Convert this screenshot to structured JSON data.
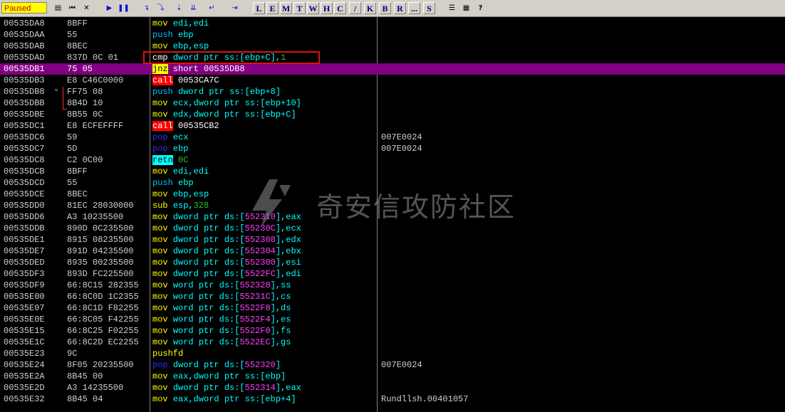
{
  "toolbar": {
    "status": "Paused",
    "icons": [
      "open-icon",
      "restart-icon",
      "close-icon",
      "run-icon",
      "pause-icon",
      "step-into-icon",
      "step-over-icon",
      "trace-into-icon",
      "trace-over-icon",
      "execute-till-return-icon",
      "go-to-icon"
    ],
    "letters": [
      "L",
      "E",
      "M",
      "T",
      "W",
      "H",
      "C",
      "/",
      "K",
      "B",
      "R",
      "...",
      "S"
    ],
    "extra_icons": [
      "options-icon",
      "colors-icon",
      "help-icon"
    ],
    "help_label": "?"
  },
  "rows": [
    {
      "addr": "00535DA8",
      "hex": "8BFF",
      "op": "mov",
      "opk": "mov",
      "args": [
        [
          "edi,edi",
          "opr-c"
        ]
      ],
      "cmt": ""
    },
    {
      "addr": "00535DAA",
      "hex": "55",
      "op": "push",
      "opk": "push",
      "args": [
        [
          "ebp",
          "opr-c"
        ]
      ],
      "cmt": ""
    },
    {
      "addr": "00535DAB",
      "hex": "8BEC",
      "op": "mov",
      "opk": "mov",
      "args": [
        [
          "ebp,esp",
          "opr-c"
        ]
      ],
      "cmt": ""
    },
    {
      "addr": "00535DAD",
      "hex": "837D 0C 01",
      "op": "cmp",
      "opk": "cmp",
      "args": [
        [
          "dword ptr ss:[ebp+C],",
          "opr-c"
        ],
        [
          "1",
          "imm"
        ]
      ],
      "cmt": ""
    },
    {
      "addr": "00535DB1",
      "hex": "75 05",
      "op": "jnz",
      "opk": "jnz",
      "args": [
        [
          "short 00535DB8",
          "opr"
        ]
      ],
      "cmt": "",
      "sel": true
    },
    {
      "addr": "00535DB3",
      "hex": "E8 C46C0000",
      "op": "call",
      "opk": "call",
      "args": [
        [
          "0053CA7C",
          "opr"
        ]
      ],
      "cmt": ""
    },
    {
      "addr": "00535DB8",
      "hex": "FF75 08",
      "op": "push",
      "opk": "push",
      "args": [
        [
          "dword ptr ss:[ebp+8]",
          "opr-c"
        ]
      ],
      "cmt": ""
    },
    {
      "addr": "00535DBB",
      "hex": "8B4D 10",
      "op": "mov",
      "opk": "mov",
      "args": [
        [
          "ecx,dword ptr ss:[ebp+10]",
          "opr-c"
        ]
      ],
      "cmt": ""
    },
    {
      "addr": "00535DBE",
      "hex": "8B55 0C",
      "op": "mov",
      "opk": "mov",
      "args": [
        [
          "edx,dword ptr ss:[ebp+C]",
          "opr-c"
        ]
      ],
      "cmt": ""
    },
    {
      "addr": "00535DC1",
      "hex": "E8 ECFEFFFF",
      "op": "call",
      "opk": "call",
      "args": [
        [
          "00535CB2",
          "opr"
        ]
      ],
      "cmt": ""
    },
    {
      "addr": "00535DC6",
      "hex": "59",
      "op": "pop",
      "opk": "pop",
      "args": [
        [
          "ecx",
          "opr-c"
        ]
      ],
      "cmt": "007E0024"
    },
    {
      "addr": "00535DC7",
      "hex": "5D",
      "op": "pop",
      "opk": "pop",
      "args": [
        [
          "ebp",
          "opr-c"
        ]
      ],
      "cmt": "007E0024"
    },
    {
      "addr": "00535DC8",
      "hex": "C2 0C00",
      "op": "retn",
      "opk": "retn",
      "args": [
        [
          "0C",
          "imm"
        ]
      ],
      "cmt": ""
    },
    {
      "addr": "00535DCB",
      "hex": "8BFF",
      "op": "mov",
      "opk": "mov",
      "args": [
        [
          "edi,edi",
          "opr-c"
        ]
      ],
      "cmt": ""
    },
    {
      "addr": "00535DCD",
      "hex": "55",
      "op": "push",
      "opk": "push",
      "args": [
        [
          "ebp",
          "opr-c"
        ]
      ],
      "cmt": ""
    },
    {
      "addr": "00535DCE",
      "hex": "8BEC",
      "op": "mov",
      "opk": "mov",
      "args": [
        [
          "ebp,esp",
          "opr-c"
        ]
      ],
      "cmt": ""
    },
    {
      "addr": "00535DD0",
      "hex": "81EC 28030000",
      "op": "sub",
      "opk": "sub",
      "args": [
        [
          "esp,",
          "opr-c"
        ],
        [
          "328",
          "imm"
        ]
      ],
      "cmt": ""
    },
    {
      "addr": "00535DD6",
      "hex": "A3 10235500",
      "op": "mov",
      "opk": "mov",
      "args": [
        [
          "dword ptr ds:[",
          "opr-c"
        ],
        [
          "552310",
          "mem"
        ],
        [
          "],eax",
          "opr-c"
        ]
      ],
      "cmt": ""
    },
    {
      "addr": "00535DDB",
      "hex": "890D 0C235500",
      "op": "mov",
      "opk": "mov",
      "args": [
        [
          "dword ptr ds:[",
          "opr-c"
        ],
        [
          "55230C",
          "mem"
        ],
        [
          "],ecx",
          "opr-c"
        ]
      ],
      "cmt": ""
    },
    {
      "addr": "00535DE1",
      "hex": "8915 08235500",
      "op": "mov",
      "opk": "mov",
      "args": [
        [
          "dword ptr ds:[",
          "opr-c"
        ],
        [
          "552308",
          "mem"
        ],
        [
          "],edx",
          "opr-c"
        ]
      ],
      "cmt": ""
    },
    {
      "addr": "00535DE7",
      "hex": "891D 04235500",
      "op": "mov",
      "opk": "mov",
      "args": [
        [
          "dword ptr ds:[",
          "opr-c"
        ],
        [
          "552304",
          "mem"
        ],
        [
          "],ebx",
          "opr-c"
        ]
      ],
      "cmt": ""
    },
    {
      "addr": "00535DED",
      "hex": "8935 00235500",
      "op": "mov",
      "opk": "mov",
      "args": [
        [
          "dword ptr ds:[",
          "opr-c"
        ],
        [
          "552300",
          "mem"
        ],
        [
          "],esi",
          "opr-c"
        ]
      ],
      "cmt": ""
    },
    {
      "addr": "00535DF3",
      "hex": "893D FC225500",
      "op": "mov",
      "opk": "mov",
      "args": [
        [
          "dword ptr ds:[",
          "opr-c"
        ],
        [
          "5522FC",
          "mem"
        ],
        [
          "],edi",
          "opr-c"
        ]
      ],
      "cmt": ""
    },
    {
      "addr": "00535DF9",
      "hex": "66:8C15 282355",
      "op": "mov",
      "opk": "mov",
      "args": [
        [
          "word ptr ds:[",
          "opr-c"
        ],
        [
          "552328",
          "mem"
        ],
        [
          "],ss",
          "opr-c"
        ]
      ],
      "cmt": ""
    },
    {
      "addr": "00535E00",
      "hex": "66:8C0D 1C2355",
      "op": "mov",
      "opk": "mov",
      "args": [
        [
          "word ptr ds:[",
          "opr-c"
        ],
        [
          "55231C",
          "mem"
        ],
        [
          "],cs",
          "opr-c"
        ]
      ],
      "cmt": ""
    },
    {
      "addr": "00535E07",
      "hex": "66:8C1D F82255",
      "op": "mov",
      "opk": "mov",
      "args": [
        [
          "word ptr ds:[",
          "opr-c"
        ],
        [
          "5522F8",
          "mem"
        ],
        [
          "],ds",
          "opr-c"
        ]
      ],
      "cmt": ""
    },
    {
      "addr": "00535E0E",
      "hex": "66:8C05 F42255",
      "op": "mov",
      "opk": "mov",
      "args": [
        [
          "word ptr ds:[",
          "opr-c"
        ],
        [
          "5522F4",
          "mem"
        ],
        [
          "],es",
          "opr-c"
        ]
      ],
      "cmt": ""
    },
    {
      "addr": "00535E15",
      "hex": "66:8C25 F02255",
      "op": "mov",
      "opk": "mov",
      "args": [
        [
          "word ptr ds:[",
          "opr-c"
        ],
        [
          "5522F0",
          "mem"
        ],
        [
          "],fs",
          "opr-c"
        ]
      ],
      "cmt": ""
    },
    {
      "addr": "00535E1C",
      "hex": "66:8C2D EC2255",
      "op": "mov",
      "opk": "mov",
      "args": [
        [
          "word ptr ds:[",
          "opr-c"
        ],
        [
          "5522EC",
          "mem"
        ],
        [
          "],gs",
          "opr-c"
        ]
      ],
      "cmt": ""
    },
    {
      "addr": "00535E23",
      "hex": "9C",
      "op": "pushfd",
      "opk": "pushfd",
      "args": [],
      "cmt": ""
    },
    {
      "addr": "00535E24",
      "hex": "8F05 20235500",
      "op": "pop",
      "opk": "pop",
      "args": [
        [
          "dword ptr ds:[",
          "opr-c"
        ],
        [
          "552320",
          "mem"
        ],
        [
          "]",
          "opr-c"
        ]
      ],
      "cmt": "007E0024"
    },
    {
      "addr": "00535E2A",
      "hex": "8B45 00",
      "op": "mov",
      "opk": "mov",
      "args": [
        [
          "eax,dword ptr ss:[ebp]",
          "opr-c"
        ]
      ],
      "cmt": ""
    },
    {
      "addr": "00535E2D",
      "hex": "A3 14235500",
      "op": "mov",
      "opk": "mov",
      "args": [
        [
          "dword ptr ds:[",
          "opr-c"
        ],
        [
          "552314",
          "mem"
        ],
        [
          "],eax",
          "opr-c"
        ]
      ],
      "cmt": ""
    },
    {
      "addr": "00535E32",
      "hex": "8B45 04",
      "op": "mov",
      "opk": "mov",
      "args": [
        [
          "eax,dword ptr ss:[ebp+4]",
          "opr-c"
        ]
      ],
      "cmt": "Rundllsh.00401057"
    }
  ],
  "watermark": {
    "text": "奇安信攻防社区"
  },
  "colors": {
    "selection": "#800080",
    "highlight_box": "#e01010",
    "toolbar": "#d4d0c8",
    "status_bg": "#ffff00"
  }
}
